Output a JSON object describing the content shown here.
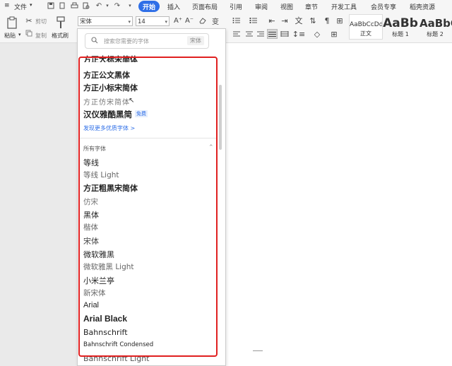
{
  "menubar": {
    "menu_label": "文件",
    "start_label": "开始",
    "tabs": [
      "插入",
      "页面布局",
      "引用",
      "审阅",
      "视图",
      "章节",
      "开发工具",
      "会员专享",
      "稻壳资源"
    ]
  },
  "toolbar": {
    "paste_label": "粘贴",
    "cut_label": "剪切",
    "copy_label": "复制",
    "format_painter_label": "格式刷",
    "font_name": "宋体",
    "font_size": "14",
    "styles": [
      {
        "sample": "AaBbCcDd",
        "name": "正文"
      },
      {
        "sample": "AaBb",
        "name": "标题 1"
      },
      {
        "sample": "AaBbC",
        "name": "标题 2"
      }
    ]
  },
  "font_panel": {
    "search_placeholder": "搜索您需要的字体",
    "search_tag": "宋体",
    "recent_fonts": [
      "方正大标宋简体",
      "方正公文黑体",
      "方正小标宋简体",
      "方正仿宋简体",
      "汉仪雅酷黑简"
    ],
    "free_badge": "免费",
    "discover_link": "发现更多优质字体 >",
    "section_title": "所有字体",
    "all_fonts": [
      "等线",
      "等线 Light",
      "方正粗黑宋简体",
      "仿宋",
      "黑体",
      "楷体",
      "宋体",
      "微软雅黑",
      "微软雅黑 Light",
      "小米兰亭",
      "新宋体",
      "Arial",
      "Arial Black",
      "Bahnschrift",
      "Bahnschrift Condensed",
      "Bahnschrift Light"
    ]
  },
  "colors": {
    "accent": "#2f6fe7",
    "highlight_frame": "#e02020",
    "link": "#2f6fe7"
  }
}
